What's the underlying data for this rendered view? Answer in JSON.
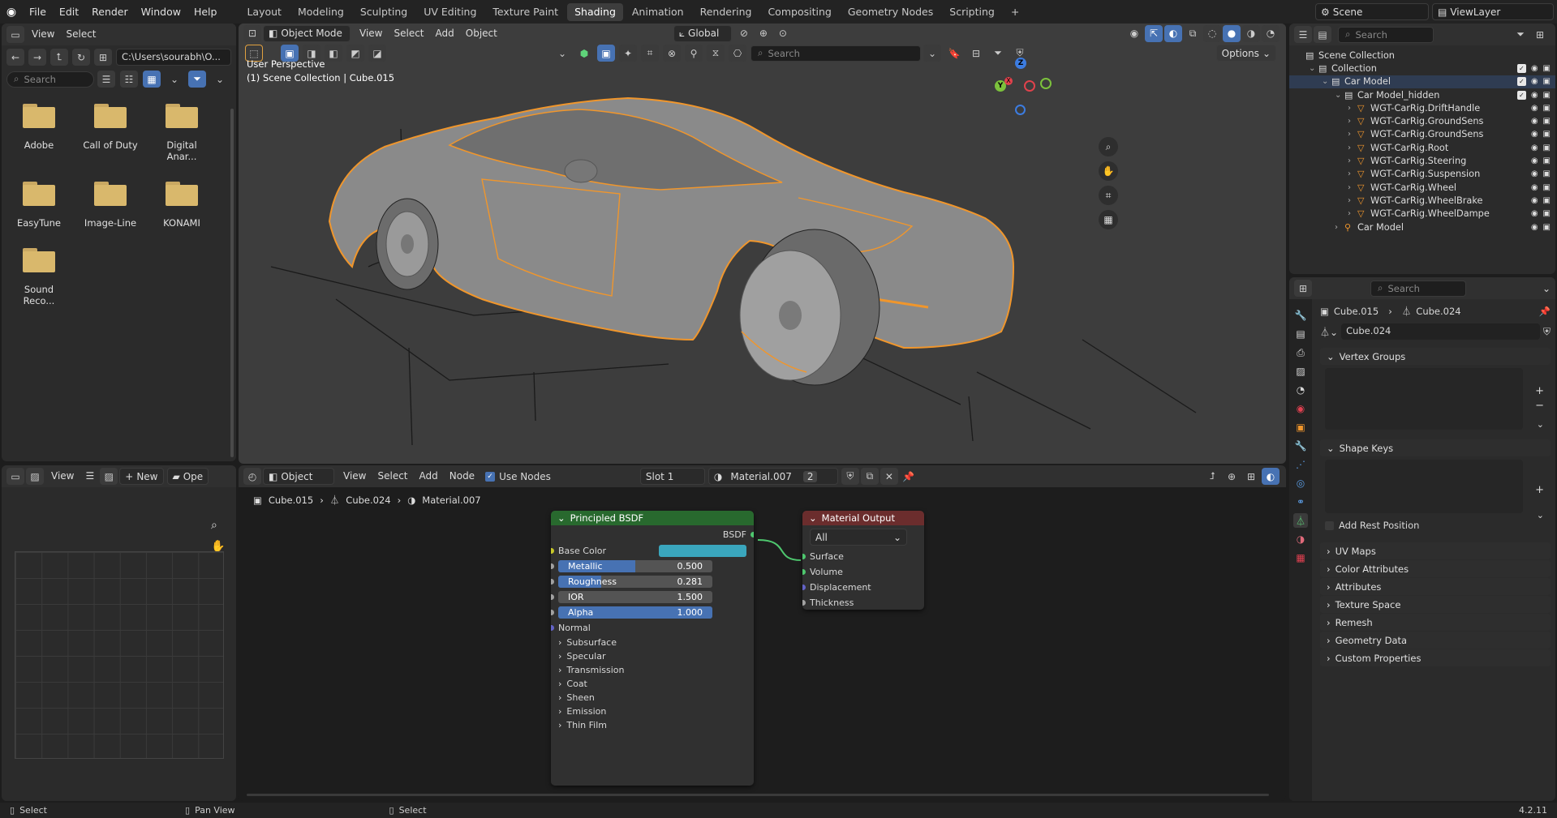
{
  "topbar": {
    "menus": [
      "File",
      "Edit",
      "Render",
      "Window",
      "Help"
    ],
    "workspaces": [
      "Layout",
      "Modeling",
      "Sculpting",
      "UV Editing",
      "Texture Paint",
      "Shading",
      "Animation",
      "Rendering",
      "Compositing",
      "Geometry Nodes",
      "Scripting"
    ],
    "active_workspace": "Shading",
    "add_tab": "+",
    "scene": "Scene",
    "view_layer": "ViewLayer"
  },
  "file_browser": {
    "header": {
      "view": "View",
      "select": "Select"
    },
    "path": "C:\\Users\\sourabh\\O...",
    "search_placeholder": "Search",
    "folders": [
      "Adobe",
      "Call of Duty",
      "Digital Anar...",
      "EasyTune",
      "Image-Line",
      "KONAMI",
      "Sound Reco..."
    ]
  },
  "image_editor": {
    "view": "View",
    "new": "New",
    "open": "Ope"
  },
  "viewport": {
    "mode": "Object Mode",
    "menus": [
      "View",
      "Select",
      "Add",
      "Object"
    ],
    "transform": "Global",
    "search_placeholder": "Search",
    "options": "Options",
    "info_line1": "User Perspective",
    "info_line2": "(1) Scene Collection | Cube.015",
    "gizmo": {
      "x": "X",
      "y": "Y",
      "z": "Z"
    }
  },
  "node_editor": {
    "type": "Object",
    "menus": [
      "View",
      "Select",
      "Add",
      "Node"
    ],
    "use_nodes": "Use Nodes",
    "slot": "Slot 1",
    "material": "Material.007",
    "users": "2",
    "breadcrumb": [
      "Cube.015",
      "Cube.024",
      "Material.007"
    ],
    "bsdf": {
      "title": "Principled BSDF",
      "output": "BSDF",
      "base_color_label": "Base Color",
      "base_color": "#3aa6bd",
      "fields": [
        {
          "label": "Metallic",
          "value": "0.500",
          "fraction": 0.5
        },
        {
          "label": "Roughness",
          "value": "0.281",
          "fraction": 0.281
        },
        {
          "label": "IOR",
          "value": "1.500",
          "fraction": 0
        },
        {
          "label": "Alpha",
          "value": "1.000",
          "fraction": 1.0
        }
      ],
      "normal": "Normal",
      "panels": [
        "Subsurface",
        "Specular",
        "Transmission",
        "Coat",
        "Sheen",
        "Emission",
        "Thin Film"
      ]
    },
    "output": {
      "title": "Material Output",
      "target": "All",
      "inputs": [
        "Surface",
        "Volume",
        "Displacement",
        "Thickness"
      ]
    }
  },
  "outliner": {
    "search_placeholder": "Search",
    "rows": [
      {
        "label": "Scene Collection",
        "indent": 0
      },
      {
        "label": "Collection",
        "indent": 1
      },
      {
        "label": "Car Model",
        "indent": 2
      },
      {
        "label": "Car Model_hidden",
        "indent": 3
      },
      {
        "label": "WGT-CarRig.DriftHandle",
        "indent": 4
      },
      {
        "label": "WGT-CarRig.GroundSens",
        "indent": 4
      },
      {
        "label": "WGT-CarRig.GroundSens",
        "indent": 4
      },
      {
        "label": "WGT-CarRig.Root",
        "indent": 4
      },
      {
        "label": "WGT-CarRig.Steering",
        "indent": 4
      },
      {
        "label": "WGT-CarRig.Suspension",
        "indent": 4
      },
      {
        "label": "WGT-CarRig.Wheel",
        "indent": 4
      },
      {
        "label": "WGT-CarRig.WheelBrake",
        "indent": 4
      },
      {
        "label": "WGT-CarRig.WheelDampe",
        "indent": 4
      },
      {
        "label": "Car Model",
        "indent": 3
      }
    ]
  },
  "properties": {
    "search_placeholder": "Search",
    "breadcrumb": [
      "Cube.015",
      "Cube.024"
    ],
    "mesh_name": "Cube.024",
    "vertex_groups": "Vertex Groups",
    "shape_keys": "Shape Keys",
    "add_rest_position": "Add Rest Position",
    "sections": [
      "UV Maps",
      "Color Attributes",
      "Attributes",
      "Texture Space",
      "Remesh",
      "Geometry Data",
      "Custom Properties"
    ]
  },
  "statusbar": {
    "select": "Select",
    "pan_view": "Pan View",
    "select2": "Select",
    "version": "4.2.11"
  },
  "colors": {
    "accent": "#4772b3",
    "selection": "#f0962c",
    "bsdf_header": "#28692e",
    "output_header": "#6b2d2d"
  }
}
